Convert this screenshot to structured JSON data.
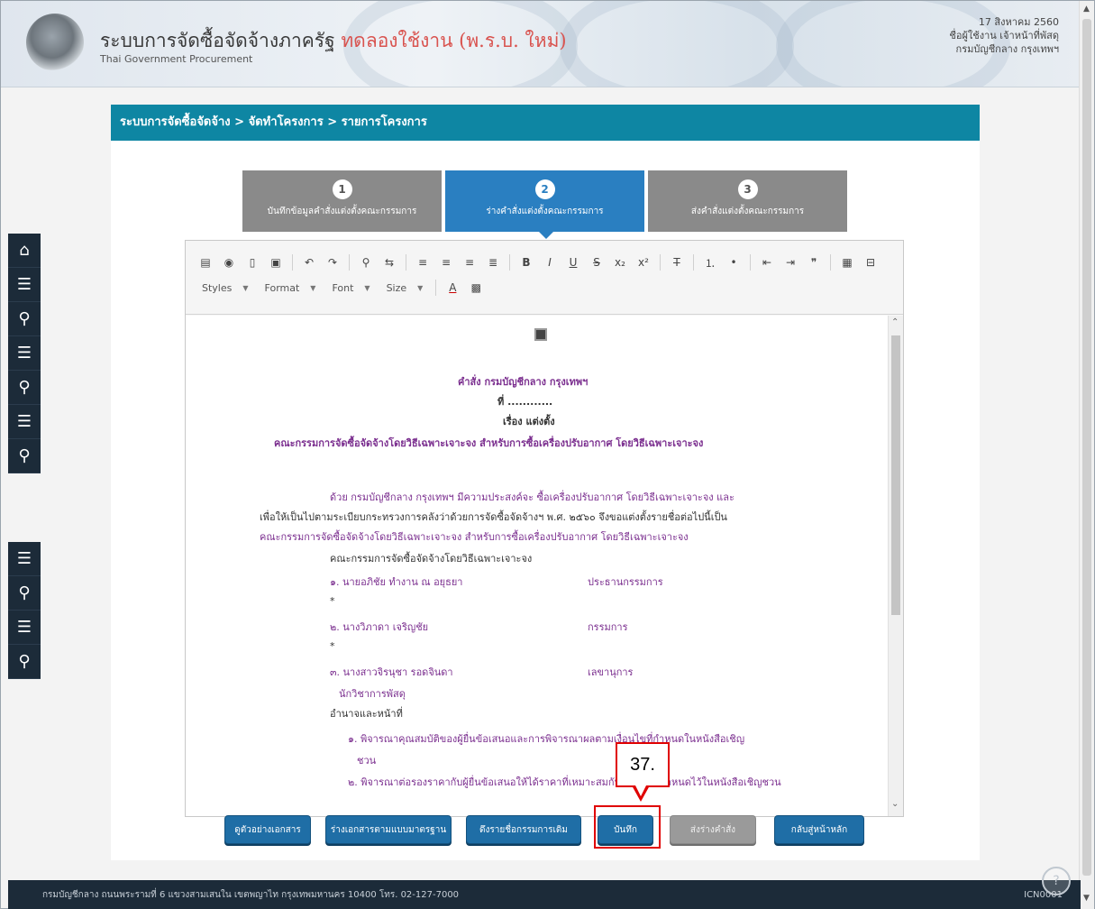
{
  "header": {
    "title_main": "ระบบการจัดซื้อจัดจ้างภาครัฐ",
    "title_highlight": "ทดลองใช้งาน (พ.ร.บ. ใหม่)",
    "subtitle": "Thai Government Procurement",
    "user_line1": "17 สิงหาคม 2560",
    "user_line2": "ชื่อผู้ใช้งาน เจ้าหน้าที่พัสดุ",
    "user_line3": "กรมบัญชีกลาง กรุงเทพฯ"
  },
  "breadcrumb": "ระบบการจัดซื้อจัดจ้าง > จัดทำโครงการ > รายการโครงการ",
  "steps": [
    {
      "num": "1",
      "label": "บันทึกข้อมูลคำสั่งแต่งตั้งคณะกรรมการ"
    },
    {
      "num": "2",
      "label": "ร่างคำสั่งแต่งตั้งคณะกรรมการ"
    },
    {
      "num": "3",
      "label": "ส่งคำสั่งแต่งตั้งคณะกรรมการ"
    }
  ],
  "toolbar": {
    "styles": "Styles",
    "format": "Format",
    "font": "Font",
    "size": "Size"
  },
  "document": {
    "line1": "คำสั่ง กรมบัญชีกลาง กรุงเทพฯ",
    "line2": "ที่ ............",
    "line3": "เรื่อง แต่งตั้ง",
    "line4": "คณะกรรมการจัดซื้อจัดจ้างโดยวิธีเฉพาะเจาะจง สำหรับการซื้อเครื่องปรับอากาศ โดยวิธีเฉพาะเจาะจง",
    "para1": "ด้วย กรมบัญชีกลาง กรุงเทพฯ มีความประสงค์จะ ซื้อเครื่องปรับอากาศ โดยวิธีเฉพาะเจาะจง และ",
    "para2": "เพื่อให้เป็นไปตามระเบียบกระทรวงการคลังว่าด้วยการจัดซื้อจัดจ้างฯ พ.ศ. ๒๕๖๐ จึงขอแต่งตั้งรายชื่อต่อไปนี้เป็น",
    "para3": "คณะกรรมการจัดซื้อจัดจ้างโดยวิธีเฉพาะเจาะจง สำหรับการซื้อเครื่องปรับอากาศ โดยวิธีเฉพาะเจาะจง",
    "committee_title": "คณะกรรมการจัดซื้อจัดจ้างโดยวิธีเฉพาะเจาะจง",
    "members": [
      {
        "name": "๑. นายอภิชัย ทำงาน ณ อยุธยา",
        "role": "ประธานกรรมการ"
      },
      {
        "name": "๒. นางวิภาดา เจริญชัย",
        "role": "กรรมการ"
      },
      {
        "name": "๓. นางสาวจิรนุชา รอดจินดา",
        "role": "เลขานุการ"
      }
    ],
    "member3_title": "นักวิชาการพัสดุ",
    "duties_title": "อำนาจและหน้าที่",
    "duty1": "๑. พิจารณาคุณสมบัติของผู้ยื่นข้อเสนอและการพิจารณาผลตามเงื่อนไขที่กำหนดในหนังสือเชิญ",
    "duty1_cont": "ชวน",
    "duty2": "๒. พิจารณาต่อรองราคากับผู้ยื่นข้อเสนอให้ได้ราคาที่เหมาะสมกับเงื่อนไขที่กำหนดไว้ในหนังสือเชิญชวน"
  },
  "actions": {
    "btn1": "ดูตัวอย่างเอกสาร",
    "btn2": "ร่างเอกสารตามแบบมาตรฐาน",
    "btn3": "ดึงรายชื่อกรรมการเดิม",
    "save": "บันทึก",
    "btn5": "ส่งร่างคำสั่ง",
    "back": "กลับสู่หน้าหลัก"
  },
  "annotation": "37.",
  "footer": {
    "text": "กรมบัญชีกลาง ถนนพระรามที่ 6 แขวงสามเสนใน เขตพญาไท กรุงเทพมหานคร 10400 โทร. 02-127-7000",
    "code": "ICN0001"
  }
}
